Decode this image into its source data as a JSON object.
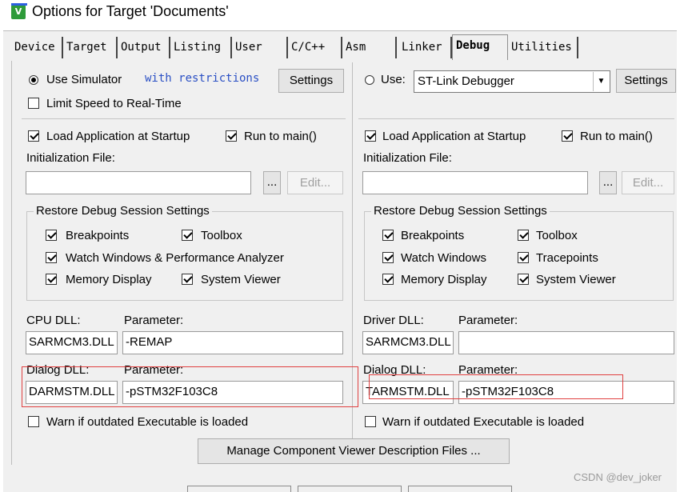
{
  "window": {
    "icon": "keil-uvision-icon",
    "title": "Options for Target 'Documents'"
  },
  "tabs": [
    {
      "label": "Device"
    },
    {
      "label": "Target"
    },
    {
      "label": "Output"
    },
    {
      "label": "Listing"
    },
    {
      "label": "User"
    },
    {
      "label": "C/C++"
    },
    {
      "label": "Asm"
    },
    {
      "label": "Linker"
    },
    {
      "label": "Debug",
      "active": true
    },
    {
      "label": "Utilities"
    }
  ],
  "left": {
    "use_simulator": {
      "label": "Use Simulator",
      "selected": true
    },
    "restrictions_link": "with restrictions",
    "settings_button": "Settings",
    "limit_speed": {
      "label": "Limit Speed to Real-Time",
      "checked": false
    },
    "load_app": {
      "label": "Load Application at Startup",
      "checked": true
    },
    "run_to_main": {
      "label": "Run to main()",
      "checked": true
    },
    "init_file_label": "Initialization File:",
    "init_file_value": "",
    "browse_button": "...",
    "edit_button": "Edit...",
    "restore_group": {
      "legend": "Restore Debug Session Settings",
      "breakpoints": "Breakpoints",
      "toolbox": "Toolbox",
      "watch_windows": "Watch Windows & Performance Analyzer",
      "memory_display": "Memory Display",
      "system_viewer": "System Viewer"
    },
    "cpu_dll_label": "CPU DLL:",
    "cpu_param_label": "Parameter:",
    "cpu_dll_value": "SARMCM3.DLL",
    "cpu_param_value": "-REMAP",
    "dialog_dll_label": "Dialog DLL:",
    "dialog_param_label": "Parameter:",
    "dialog_dll_value": "DARMSTM.DLL",
    "dialog_param_value": "-pSTM32F103C8",
    "warn_outdated": {
      "label": "Warn if outdated Executable is loaded",
      "checked": false
    }
  },
  "right": {
    "use": {
      "label": "Use:",
      "selected": false
    },
    "debugger_select": "ST-Link Debugger",
    "settings_button": "Settings",
    "load_app": {
      "label": "Load Application at Startup",
      "checked": true
    },
    "run_to_main": {
      "label": "Run to main()",
      "checked": true
    },
    "init_file_label": "Initialization File:",
    "init_file_value": "",
    "browse_button": "...",
    "edit_button": "Edit...",
    "restore_group": {
      "legend": "Restore Debug Session Settings",
      "breakpoints": "Breakpoints",
      "toolbox": "Toolbox",
      "watch_windows": "Watch Windows",
      "tracepoints": "Tracepoints",
      "memory_display": "Memory Display",
      "system_viewer": "System Viewer"
    },
    "driver_dll_label": "Driver DLL:",
    "driver_param_label": "Parameter:",
    "driver_dll_value": "SARMCM3.DLL",
    "driver_param_value": "",
    "dialog_dll_label": "Dialog DLL:",
    "dialog_param_label": "Parameter:",
    "dialog_dll_value": "TARMSTM.DLL",
    "dialog_param_value": "-pSTM32F103C8",
    "warn_outdated": {
      "label": "Warn if outdated Executable is loaded",
      "checked": false
    }
  },
  "manage_button": "Manage Component Viewer Description Files ...",
  "watermark": "CSDN @dev_joker",
  "colors": {
    "highlight": "#e04040",
    "link": "#2a4fc4",
    "dialog_bg": "#f0f0f0"
  }
}
